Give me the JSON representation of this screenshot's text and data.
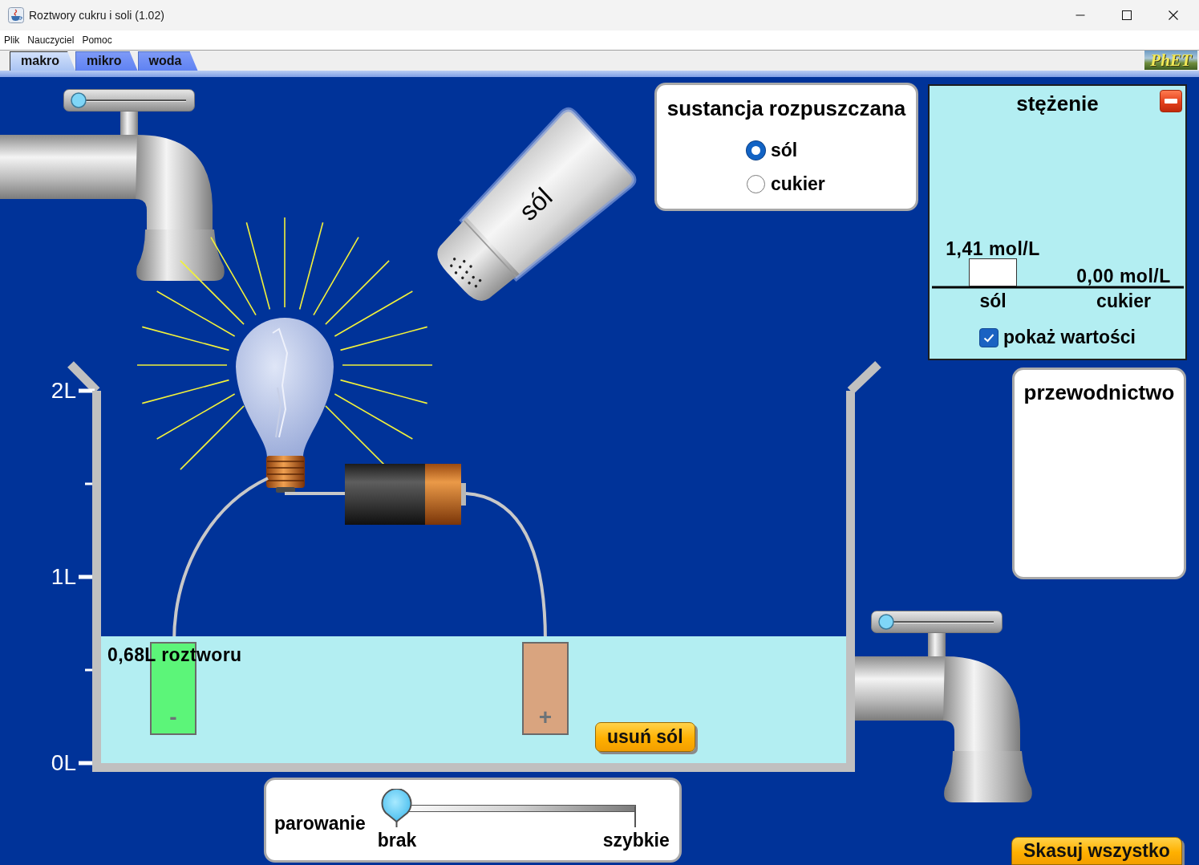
{
  "window": {
    "title": "Roztwory cukru i soli (1.02)"
  },
  "menu": [
    {
      "label": "Plik"
    },
    {
      "label": "Nauczyciel"
    },
    {
      "label": "Pomoc"
    }
  ],
  "tabs": [
    {
      "label": "makro",
      "selected": true
    },
    {
      "label": "mikro",
      "selected": false
    },
    {
      "label": "woda",
      "selected": false
    }
  ],
  "logo": {
    "text": "PhET"
  },
  "faucets": [
    {
      "level": 0
    },
    {
      "level": 0
    }
  ],
  "shaker": {
    "label": "sól"
  },
  "circuit": {
    "bulb_lit": true,
    "electrodes": [
      {
        "kind": "negative",
        "sign": "-"
      },
      {
        "kind": "positive",
        "sign": "+"
      }
    ]
  },
  "beaker": {
    "tick_labels": [
      "2L",
      "1L",
      "0L"
    ]
  },
  "solution": {
    "label": "0,68L roztworu"
  },
  "remove_button": {
    "label": "usuń sól"
  },
  "solute_panel": {
    "title": "sustancja rozpuszczana",
    "options": [
      {
        "label": "sól",
        "selected": true
      },
      {
        "label": "cukier",
        "selected": false
      }
    ]
  },
  "concentration_panel": {
    "title": "stężenie",
    "show_values": {
      "label": "pokaż wartości",
      "checked": true
    },
    "chart_data": {
      "type": "bar",
      "categories": [
        "sól",
        "cukier"
      ],
      "values": [
        1.41,
        0
      ],
      "value_labels": [
        "1,41 mol/L",
        "0,00 mol/L"
      ]
    }
  },
  "conductivity_panel": {
    "title": "przewodnictwo"
  },
  "evaporation": {
    "label": "parowanie",
    "level": 0,
    "min_label": "brak",
    "max_label": "szybkie"
  },
  "reset_button": {
    "label": "Skasuj wszystko"
  }
}
